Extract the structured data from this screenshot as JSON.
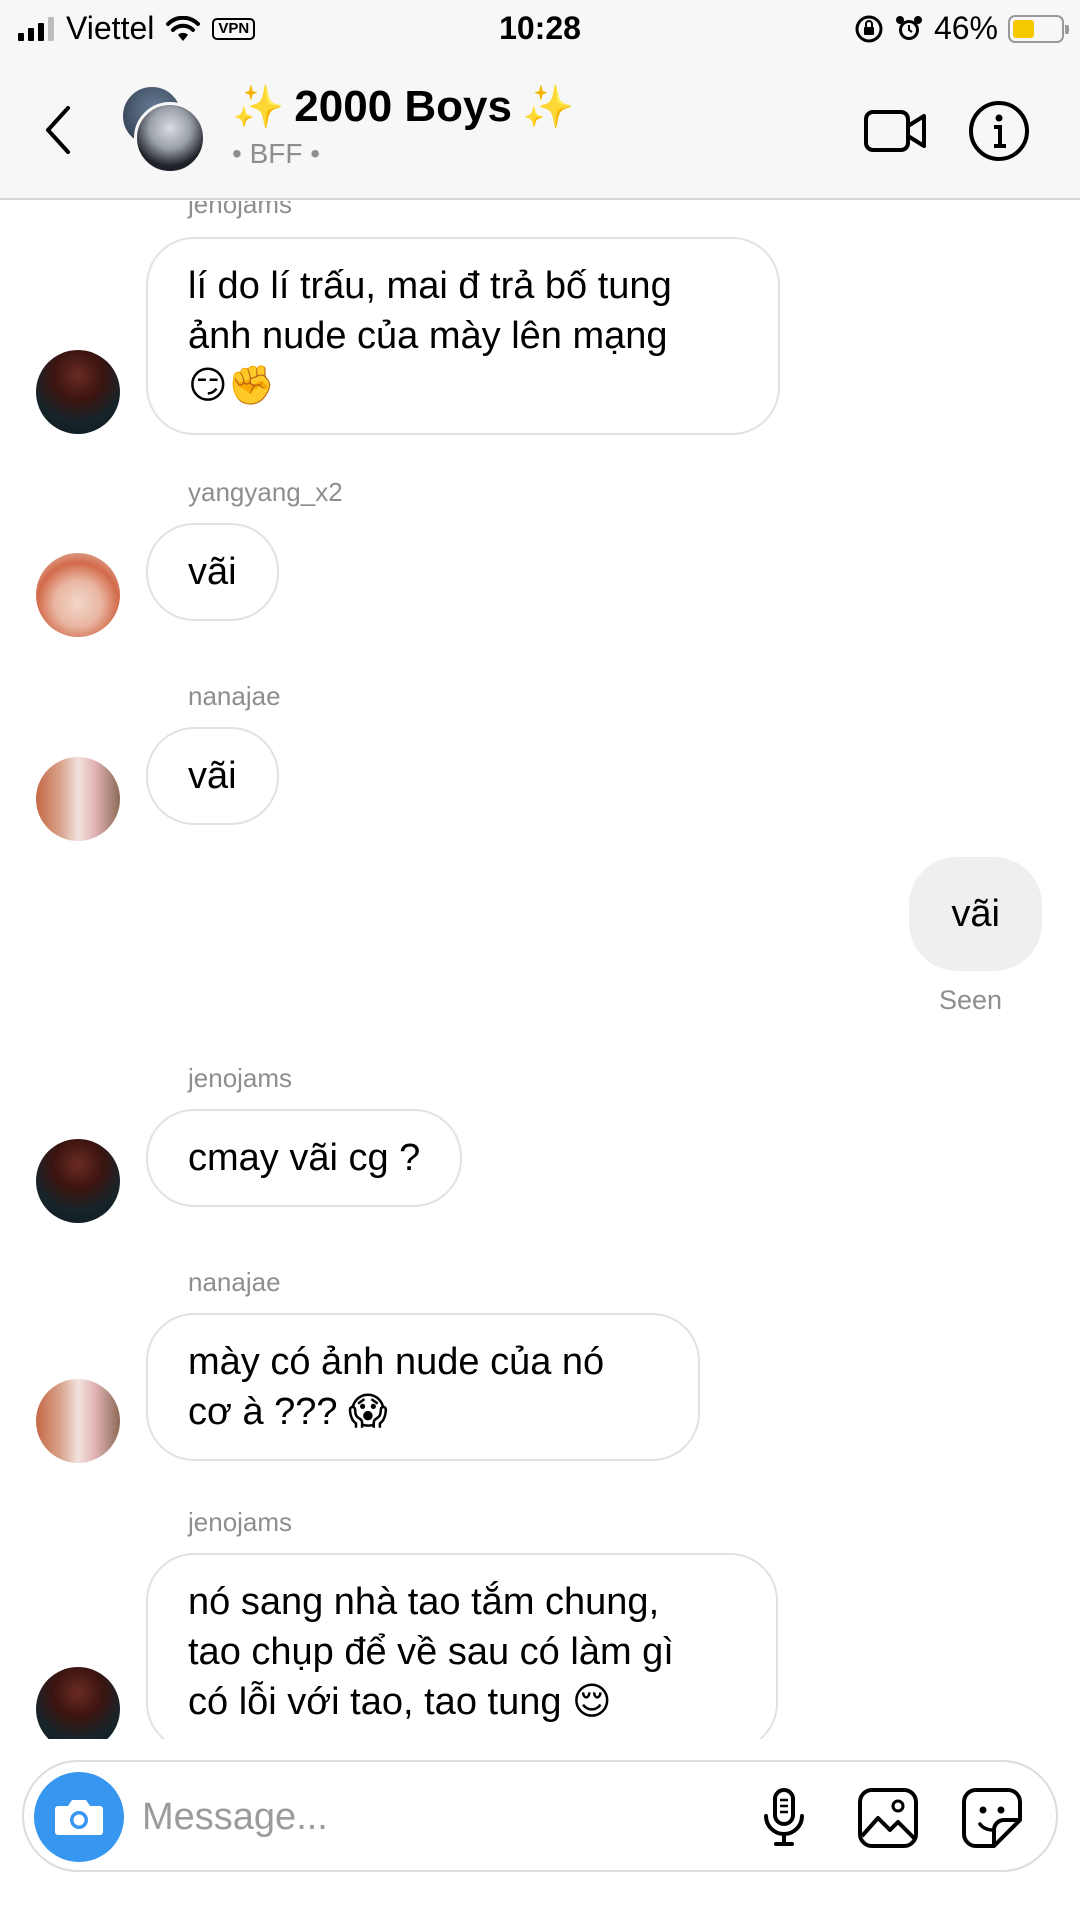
{
  "status_bar": {
    "carrier": "Viettel",
    "vpn": "VPN",
    "time": "10:28",
    "battery_pct_text": "46%",
    "battery_level": 0.46,
    "battery_color": "#f5c800"
  },
  "header": {
    "title": "2000 Boys",
    "sparkle_left": "✨",
    "sparkle_right": "✨",
    "subtitle": "• BFF •",
    "icons": [
      "back-icon",
      "video-call-icon",
      "info-icon"
    ]
  },
  "messages": [
    {
      "sender": "jenojams",
      "text": "lí do lí trấu, mai đ trả bố tung\nảnh nude của mày lên mạng\n😏✊"
    },
    {
      "sender": "yangyang_x2",
      "text": "vãi"
    },
    {
      "sender": "nanajae",
      "text": "vãi"
    },
    {
      "sender": "me",
      "text": "vãi",
      "status": "Seen"
    },
    {
      "sender": "jenojams",
      "text": "cmay vãi cg ?"
    },
    {
      "sender": "nanajae",
      "text": "mày có ảnh nude của nó\ncơ à ??? 😱"
    },
    {
      "sender": "jenojams",
      "text": "nó sang nhà tao tắm chung,\ntao chụp để về sau có làm gì\ncó lỗi với tao, tao tung 😌"
    }
  ],
  "composer": {
    "placeholder": "Message...",
    "accent": "#3797f0",
    "icons": [
      "camera-icon",
      "microphone-icon",
      "gallery-icon",
      "sticker-icon"
    ]
  }
}
